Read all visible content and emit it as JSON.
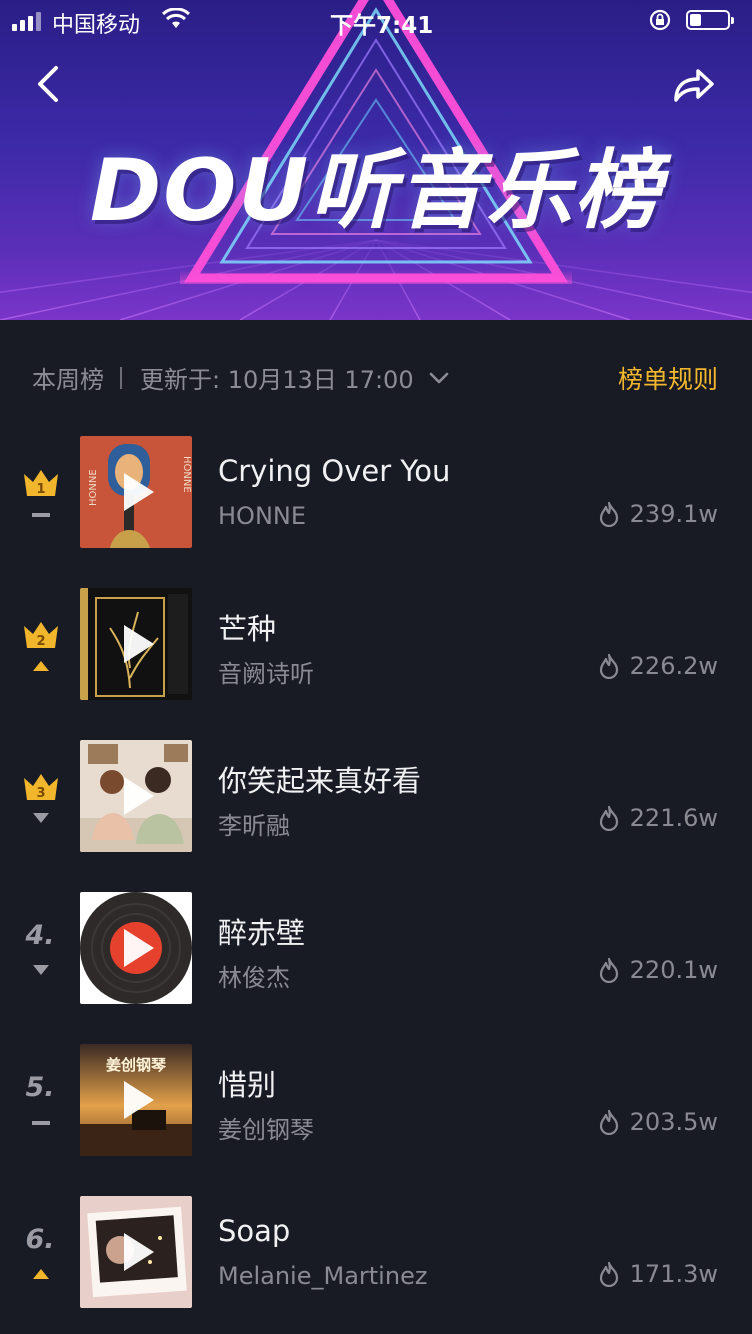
{
  "status_bar": {
    "carrier": "中国移动",
    "time": "下午7:41",
    "battery_level": 0.3
  },
  "banner": {
    "title": "DOU听音乐榜"
  },
  "icons": {
    "back": "chevron-left-icon",
    "share": "share-arrow-icon",
    "play": "play-icon",
    "heat": "flame-icon",
    "dropdown": "chevron-down-icon"
  },
  "colors": {
    "accent": "#f3b72d",
    "background": "#181a24",
    "title_text": "#f1f1f3",
    "secondary_text": "#8a8b92",
    "crown": "#f2b62c"
  },
  "meta": {
    "period": "本周榜",
    "updated": "更新于: 10月13日 17:00",
    "rules_label": "榜单规则"
  },
  "songs": [
    {
      "rank": "1",
      "trend": "same",
      "title": "Crying Over You",
      "artist": "HONNE",
      "heat": "239.1w"
    },
    {
      "rank": "2",
      "trend": "up",
      "title": "芒种",
      "artist": "音阙诗听",
      "heat": "226.2w"
    },
    {
      "rank": "3",
      "trend": "down",
      "title": "你笑起来真好看",
      "artist": "李昕融",
      "heat": "221.6w"
    },
    {
      "rank": "4.",
      "trend": "down",
      "title": "醉赤壁",
      "artist": "林俊杰",
      "heat": "220.1w"
    },
    {
      "rank": "5.",
      "trend": "same",
      "title": "惜别",
      "artist": "姜创钢琴",
      "heat": "203.5w"
    },
    {
      "rank": "6.",
      "trend": "up",
      "title": "Soap",
      "artist": "Melanie_Martinez",
      "heat": "171.3w"
    }
  ],
  "cover_texts": {
    "song1_cover": "HONNE",
    "song5_cover": "姜创钢琴"
  }
}
